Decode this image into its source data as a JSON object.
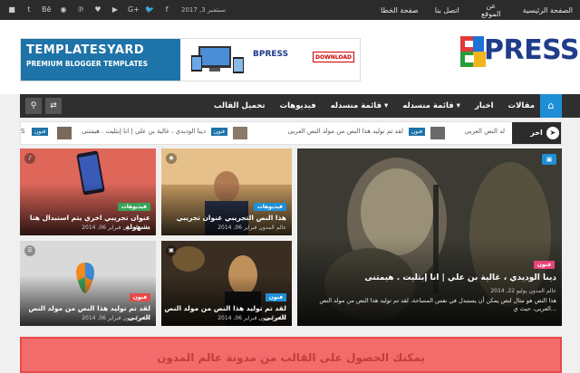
{
  "topbar": {
    "social_icons": [
      "close-square-icon",
      "tumblr-icon",
      "behance-icon",
      "rss-icon",
      "pinterest-icon",
      "heart-icon",
      "youtube-icon",
      "google-plus-icon",
      "twitter-icon",
      "facebook-icon"
    ],
    "social_glyphs": [
      "■",
      "t",
      "Bē",
      "◉",
      "℗",
      "♥",
      "▶",
      "G+",
      "🐦",
      "f"
    ],
    "date": "سبتمبر 3, 2017",
    "nav": [
      "الصفحة الرئيسية",
      "عن الموقع",
      "اتصل بنا",
      "صفحة الخطا"
    ]
  },
  "banner": {
    "line1": "TEMPLATESYARD",
    "line2": "PREMIUM BLOGGER TEMPLATES",
    "brand": "BPRESS",
    "download": "DOWNLOAD"
  },
  "logo": {
    "text": "PRESS",
    "colors": [
      "#e03a3a",
      "#2a9d3a",
      "#f2b51e",
      "#1e73d6"
    ]
  },
  "menu": {
    "items": [
      "مقالات",
      "اخبار",
      "قائمة منسدله ▾",
      "قائمة منسدله ▾",
      "فيديوهات",
      "تحميل القالب"
    ],
    "home_glyph": "⌂",
    "search_glyph": "🔍",
    "random_glyph": "⇄"
  },
  "ticker": {
    "label": "اخر الأخبار",
    "items": [
      {
        "text": "لد النص العربي",
        "tag": ""
      },
      {
        "text": "لقد تم توليد هذا النص من مولد النص العربى",
        "tag": "فنون"
      },
      {
        "text": "دينا الوديدي ، غالية بن علي | انا إبتليت . هيمتنى",
        "tag": "فنون"
      },
      {
        "text": "S",
        "tag": "فنون"
      }
    ]
  },
  "cards": {
    "big": {
      "cat": "فنون",
      "title": "دينا الوديدي ، غالية بن علي | انا إبتليت . هيمتنى",
      "meta": "عالم المدون    يوليو 22, 2014",
      "excerpt": "هذا النص هو مثال لنص يمكن أن يستبدل في نفس المساحة، لقد تم توليد هذا النص من مولد النص العربى، حيث ي..."
    },
    "tl": {
      "cat": "فيديوهات",
      "title": "هذا النص التجريبي عنوان تجريبي",
      "meta": "عالم المدون    فبراير 06, 2014"
    },
    "tr": {
      "cat": "فيديوهات",
      "title": "عنوان تجريبي اخري يتم استبدال هنا بسهولة",
      "meta": "عالم المدون    فبراير 06, 2014"
    },
    "bl": {
      "cat": "فنون",
      "title": "لقد تم توليد هذا النص من مولد النص العربى",
      "meta": "عالم المدون    فبراير 06, 2014"
    },
    "br": {
      "cat": "فنون",
      "title": "لقد تم توليد هذا النص من مولد النص العربى",
      "meta": "عالم المدون    فبراير 06, 2014"
    }
  },
  "promo": {
    "text": "يمكنك الحصول على القالب من مدونة عالم المدون"
  },
  "colors": {
    "accent": "#1e8fd6",
    "dark": "#2b2b2b",
    "pink": "#e8457a",
    "green": "#3aa35a",
    "red": "#e84a4a"
  }
}
